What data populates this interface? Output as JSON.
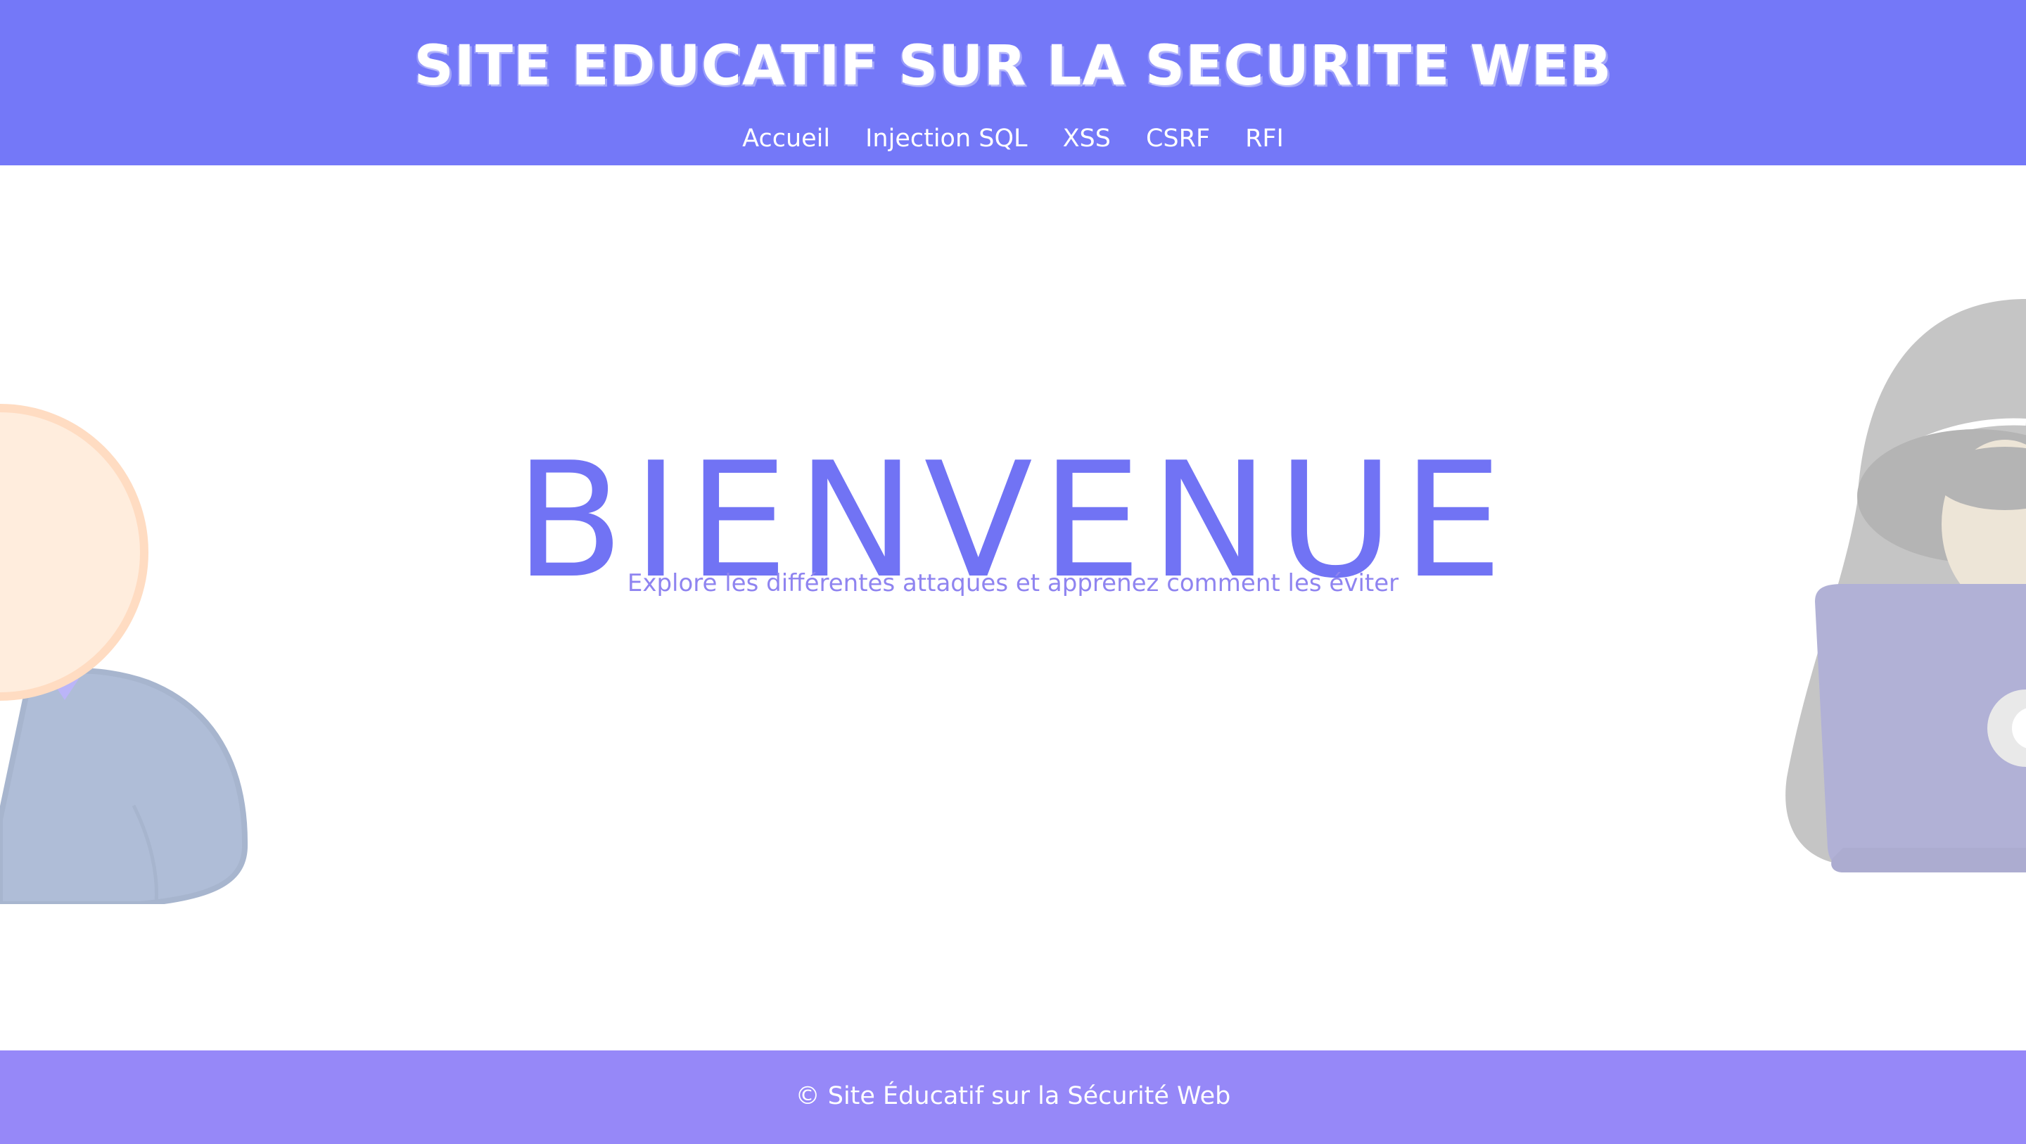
{
  "header": {
    "site_title": "SITE EDUCATIF SUR LA SECURITE WEB",
    "background_color": "#7478f8"
  },
  "nav": {
    "items": [
      {
        "label": "Accueil"
      },
      {
        "label": "Injection SQL"
      },
      {
        "label": "XSS"
      },
      {
        "label": "CSRF"
      },
      {
        "label": "RFI"
      }
    ]
  },
  "hero": {
    "title": "BIENVENUE",
    "subtitle": "Explore les différentes attaques et apprenez comment les éviter",
    "title_color": "#7173f4"
  },
  "illustrations": {
    "left": "user-illustration",
    "right": "hacker-illustration"
  },
  "footer": {
    "text": "© Site Éducatif sur la Sécurité Web",
    "background_color": "#9688f8"
  }
}
